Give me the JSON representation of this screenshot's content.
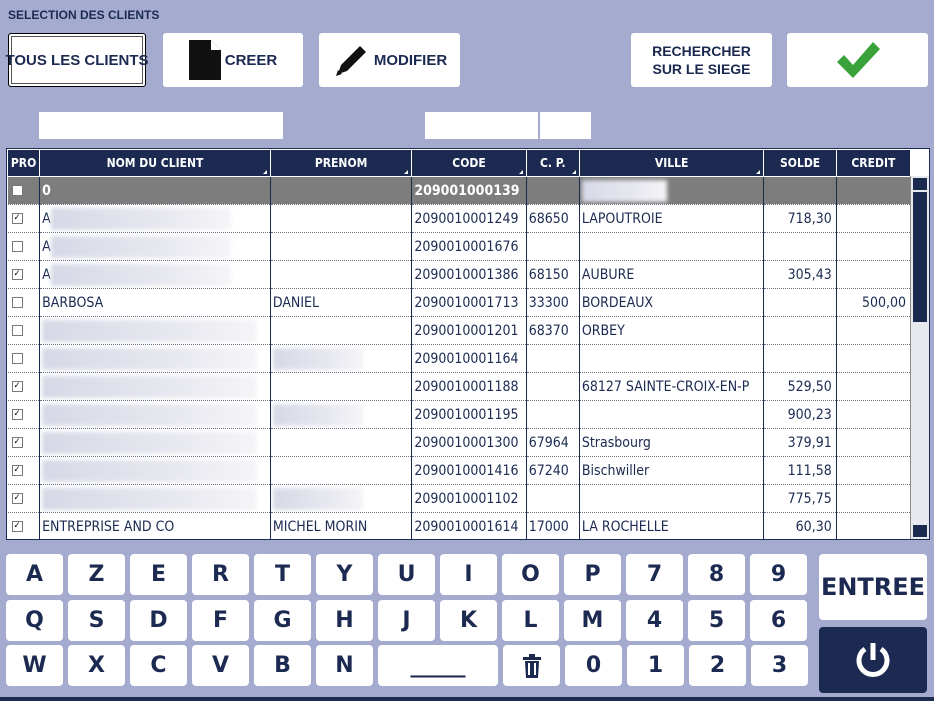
{
  "header": {
    "title": "SELECTION DES CLIENTS"
  },
  "toolbar": {
    "all_clients": "TOUS LES CLIENTS",
    "create": "CREER",
    "modify": "MODIFIER",
    "search_line1": "RECHERCHER",
    "search_line2": "SUR LE SIEGE"
  },
  "filters": {
    "name": "",
    "code": "",
    "cp": ""
  },
  "table": {
    "columns": [
      "PRO",
      "NOM DU CLIENT",
      "PRENOM",
      "CODE",
      "C. P.",
      "VILLE",
      "SOLDE",
      "CREDIT"
    ],
    "rows": [
      {
        "checked": false,
        "nom": "0",
        "prenom": "",
        "code": "209001000139",
        "cp": "",
        "ville": "",
        "solde": "",
        "credit": "",
        "blurNom": false,
        "blurVille": true
      },
      {
        "checked": true,
        "nom": "A",
        "prenom": "",
        "code": "2090010001249",
        "cp": "68650",
        "ville": "LAPOUTROIE",
        "solde": "718,30",
        "credit": "",
        "blurNom": true
      },
      {
        "checked": false,
        "nom": "A",
        "prenom": "",
        "code": "2090010001676",
        "cp": "",
        "ville": "",
        "solde": "",
        "credit": "",
        "blurNom": true
      },
      {
        "checked": true,
        "nom": "A",
        "prenom": "",
        "code": "2090010001386",
        "cp": "68150",
        "ville": "AUBURE",
        "solde": "305,43",
        "credit": "",
        "blurNom": true
      },
      {
        "checked": false,
        "nom": "BARBOSA",
        "prenom": "DANIEL",
        "code": "2090010001713",
        "cp": "33300",
        "ville": "BORDEAUX",
        "solde": "",
        "credit": "500,00"
      },
      {
        "checked": false,
        "nom": "",
        "prenom": "",
        "code": "2090010001201",
        "cp": "68370",
        "ville": "ORBEY",
        "solde": "",
        "credit": "",
        "blurNom": true
      },
      {
        "checked": false,
        "nom": "",
        "prenom": "",
        "code": "2090010001164",
        "cp": "",
        "ville": "",
        "solde": "",
        "credit": "",
        "blurNom": true,
        "blurPrenom": true
      },
      {
        "checked": true,
        "nom": "",
        "prenom": "",
        "code": "2090010001188",
        "cp": "",
        "ville": "68127 SAINTE-CROIX-EN-P",
        "solde": "529,50",
        "credit": "",
        "blurNom": true
      },
      {
        "checked": true,
        "nom": "",
        "prenom": "",
        "code": "2090010001195",
        "cp": "",
        "ville": "",
        "solde": "900,23",
        "credit": "",
        "blurNom": true,
        "blurPrenom": true
      },
      {
        "checked": true,
        "nom": "",
        "prenom": "",
        "code": "2090010001300",
        "cp": "67964",
        "ville": "Strasbourg",
        "solde": "379,91",
        "credit": "",
        "blurNom": true
      },
      {
        "checked": true,
        "nom": "",
        "prenom": "",
        "code": "2090010001416",
        "cp": "67240",
        "ville": "Bischwiller",
        "solde": "111,58",
        "credit": "",
        "blurNom": true
      },
      {
        "checked": true,
        "nom": "",
        "prenom": "",
        "code": "2090010001102",
        "cp": "",
        "ville": "",
        "solde": "775,75",
        "credit": "",
        "blurNom": true,
        "blurPrenom": true
      },
      {
        "checked": true,
        "nom": "ENTREPRISE AND CO",
        "prenom": "MICHEL MORIN",
        "code": "2090010001614",
        "cp": "17000",
        "ville": "LA ROCHELLE",
        "solde": "60,30",
        "credit": ""
      }
    ]
  },
  "keyboard": {
    "row1": [
      "A",
      "Z",
      "E",
      "R",
      "T",
      "Y",
      "U",
      "I",
      "O",
      "P",
      "7",
      "8",
      "9"
    ],
    "row2": [
      "Q",
      "S",
      "D",
      "F",
      "G",
      "H",
      "J",
      "K",
      "L",
      "M",
      "4",
      "5",
      "6"
    ],
    "row3": [
      "W",
      "X",
      "C",
      "V",
      "B",
      "N",
      "_____",
      "trash-icon",
      "0",
      "1",
      "2",
      "3"
    ],
    "enter": "ENTREE"
  },
  "colors": {
    "navy": "#1c2a52",
    "background": "#a4abcf",
    "check_green": "#3aa23a"
  }
}
